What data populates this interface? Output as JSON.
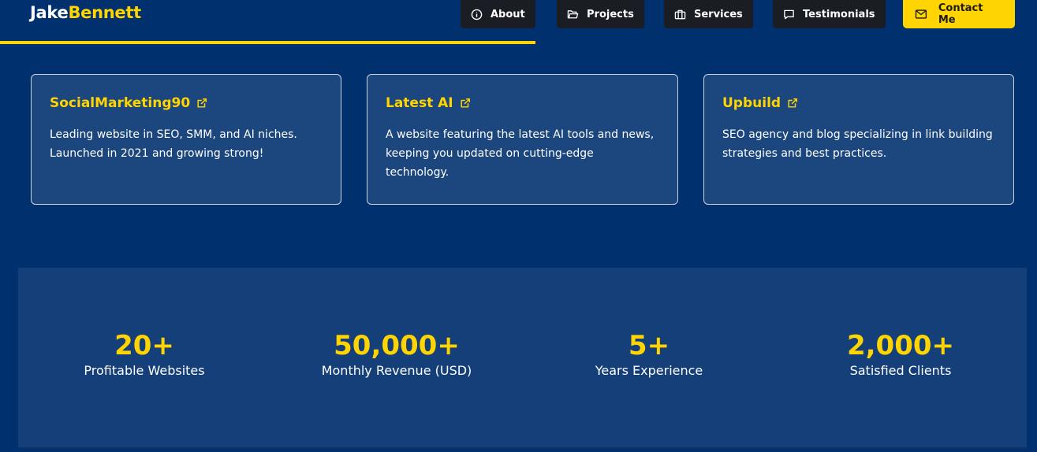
{
  "header": {
    "logo_first": "Jake",
    "logo_second": "Bennett",
    "nav": [
      {
        "label": "About",
        "icon": "info-icon"
      },
      {
        "label": "Projects",
        "icon": "folder-icon"
      },
      {
        "label": "Services",
        "icon": "briefcase-icon"
      },
      {
        "label": "Testimonials",
        "icon": "chat-icon"
      }
    ],
    "contact_label": "Contact Me",
    "contact_icon": "mail-icon",
    "scroll_progress": 0.516
  },
  "projects": [
    {
      "title": "SocialMarketing90",
      "description": "Leading website in SEO, SMM, and AI niches. Launched in 2021 and growing strong!"
    },
    {
      "title": "Latest AI",
      "description": "A website featuring the latest AI tools and news, keeping you updated on cutting-edge technology."
    },
    {
      "title": "Upbuild",
      "description": "SEO agency and blog specializing in link building strategies and best practices."
    }
  ],
  "stats": [
    {
      "value": "20+",
      "label": "Profitable Websites"
    },
    {
      "value": "50,000+",
      "label": "Monthly Revenue (USD)"
    },
    {
      "value": "5+",
      "label": "Years Experience"
    },
    {
      "value": "2,000+",
      "label": "Satisfied Clients"
    }
  ],
  "colors": {
    "background": "#01306e",
    "accent": "#ffd400",
    "card": "#1c467e",
    "nav_button": "#1a1d24"
  }
}
